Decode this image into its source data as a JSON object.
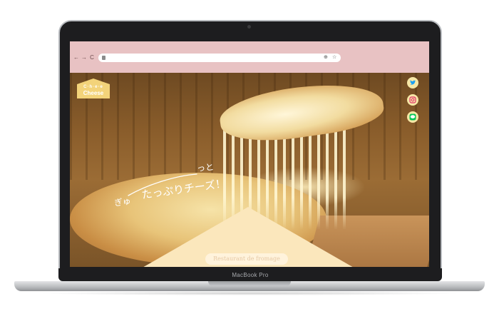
{
  "device": {
    "model_label": "MacBook Pro"
  },
  "browser": {
    "back_glyph": "←",
    "forward_glyph": "→",
    "reload_glyph": "C",
    "icons": [
      "lock-icon",
      "zoom-icon",
      "bookmark-star-icon"
    ]
  },
  "site": {
    "logo": {
      "top": "C·h·e·e",
      "bottom": "Cheese"
    },
    "tagline": {
      "part1": "ぎゅ",
      "part2": "っと",
      "part3": "たっぷりチーズ！"
    },
    "cta_label": "Restaurant de fromage",
    "social": [
      "twitter-icon",
      "instagram-icon",
      "line-icon"
    ]
  },
  "colors": {
    "chrome_bg": "#e8c2c3",
    "social_bg": "#f6e7a6",
    "logo_bg": "#f3d37a",
    "triangle_bg": "#fbe7bc",
    "twitter": "#1da1f2",
    "instagram": "#e1306c",
    "line": "#06c755"
  }
}
